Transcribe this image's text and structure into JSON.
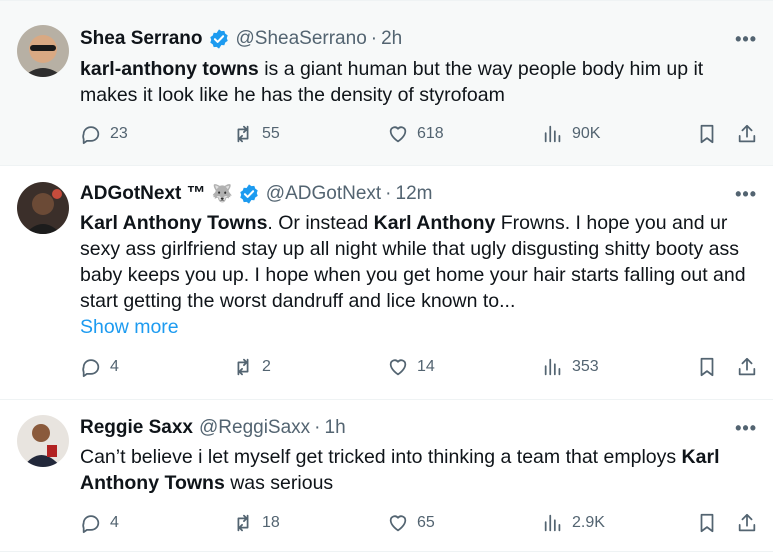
{
  "tweets": [
    {
      "name": "Shea Serrano",
      "handle": "@SheaSerrano",
      "time": "2h",
      "text_parts": [
        {
          "b": true,
          "t": "karl-anthony towns"
        },
        {
          "b": false,
          "t": " is a giant human but the way people body him up it makes it look like he has the density of styrofoam"
        }
      ],
      "replies": "23",
      "retweets": "55",
      "likes": "618",
      "views": "90K"
    },
    {
      "name": "ADGotNext ™",
      "emoji": "🐺",
      "handle": "@ADGotNext",
      "time": "12m",
      "text_parts": [
        {
          "b": true,
          "t": "Karl Anthony Towns"
        },
        {
          "b": false,
          "t": ". Or instead "
        },
        {
          "b": true,
          "t": "Karl Anthony"
        },
        {
          "b": false,
          "t": " Frowns. I hope you and ur sexy ass girlfriend stay up all night while that ugly disgusting shitty booty ass baby keeps you up. I hope when you get home your hair starts falling out and start getting the worst dandruff and lice known to..."
        }
      ],
      "show_more": "Show more",
      "replies": "4",
      "retweets": "2",
      "likes": "14",
      "views": "353"
    },
    {
      "name": "Reggie Saxx",
      "handle": "@ReggiSaxx",
      "time": "1h",
      "text_parts": [
        {
          "b": false,
          "t": "Can’t believe i let myself get tricked into thinking a team that employs "
        },
        {
          "b": true,
          "t": "Karl Anthony Towns"
        },
        {
          "b": false,
          "t": " was serious"
        }
      ],
      "replies": "4",
      "retweets": "18",
      "likes": "65",
      "views": "2.9K"
    }
  ],
  "separator": "·",
  "more_menu": "•••",
  "colors": {
    "link": "#1d9bf0",
    "muted": "#536471",
    "verified": "#1d9bf0",
    "hover_bg": "#f7f9f9"
  },
  "icons": [
    "reply-icon",
    "retweet-icon",
    "like-icon",
    "views-icon",
    "bookmark-icon",
    "share-icon",
    "verified-badge-icon",
    "more-icon"
  ]
}
